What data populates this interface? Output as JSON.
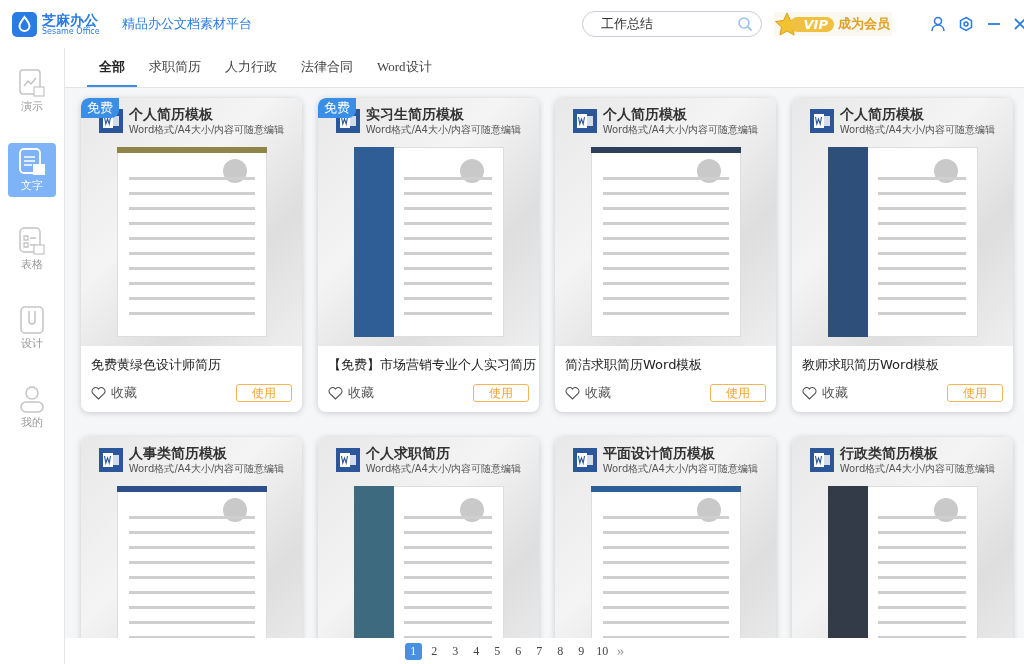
{
  "app": {
    "name": "芝麻办公",
    "name_en": "Sesame Office",
    "slogan": "精品办公文档素材平台"
  },
  "search": {
    "value": "工作总结"
  },
  "vip": {
    "badge": "VIP",
    "label": "成为会员"
  },
  "sidebar": {
    "items": [
      {
        "label": "演示",
        "kind": "slides",
        "selected": false
      },
      {
        "label": "文字",
        "kind": "doc",
        "selected": true
      },
      {
        "label": "表格",
        "kind": "sheet",
        "selected": false
      },
      {
        "label": "设计",
        "kind": "design",
        "selected": false
      },
      {
        "label": "我的",
        "kind": "user",
        "selected": false
      }
    ]
  },
  "tabs": [
    {
      "label": "全部",
      "selected": true
    },
    {
      "label": "求职简历",
      "selected": false
    },
    {
      "label": "人力行政",
      "selected": false
    },
    {
      "label": "法律合同",
      "selected": false
    },
    {
      "label": "Word设计",
      "selected": false
    }
  ],
  "cards": [
    {
      "badge": "免费",
      "thumbnail_title": "个人简历模板",
      "thumbnail_subtitle": "Word格式/A4大小/内容可随意编辑",
      "title": "免费黄绿色设计师简历",
      "favorite": "收藏",
      "use": "使用",
      "color": "#8f8548"
    },
    {
      "badge": "免费",
      "thumbnail_title": "实习生简历模板",
      "thumbnail_subtitle": "Word格式/A4大小/内容可随意编辑",
      "title": "【免费】市场营销专业个人实习简历",
      "favorite": "收藏",
      "use": "使用",
      "color": "#2f5d95"
    },
    {
      "thumbnail_title": "个人简历模板",
      "thumbnail_subtitle": "Word格式/A4大小/内容可随意编辑",
      "title": "简洁求职简历Word模板",
      "favorite": "收藏",
      "use": "使用",
      "color": "#2e3f5c"
    },
    {
      "thumbnail_title": "个人简历模板",
      "thumbnail_subtitle": "Word格式/A4大小/内容可随意编辑",
      "title": "教师求职简历Word模板",
      "favorite": "收藏",
      "use": "使用",
      "color": "#2e4f7a"
    },
    {
      "thumbnail_title": "人事类简历模板",
      "thumbnail_subtitle": "Word格式/A4大小/内容可随意编辑",
      "color": "#2e4f8a"
    },
    {
      "thumbnail_title": "个人求职简历",
      "thumbnail_subtitle": "Word格式/A4大小/内容可随意编辑",
      "color": "#3e6a80"
    },
    {
      "thumbnail_title": "平面设计简历模板",
      "thumbnail_subtitle": "Word格式/A4大小/内容可随意编辑",
      "color": "#2f5d95"
    },
    {
      "thumbnail_title": "行政类简历模板",
      "thumbnail_subtitle": "Word格式/A4大小/内容可随意编辑",
      "color": "#333a48"
    }
  ],
  "pagination": {
    "pages": [
      {
        "label": "1",
        "selected": true
      },
      {
        "label": "2",
        "selected": false
      },
      {
        "label": "3",
        "selected": false
      },
      {
        "label": "4",
        "selected": false
      },
      {
        "label": "5",
        "selected": false
      },
      {
        "label": "6",
        "selected": false
      },
      {
        "label": "7",
        "selected": false
      },
      {
        "label": "8",
        "selected": false
      },
      {
        "label": "9",
        "selected": false
      },
      {
        "label": "10",
        "selected": false
      }
    ],
    "next": "»"
  }
}
